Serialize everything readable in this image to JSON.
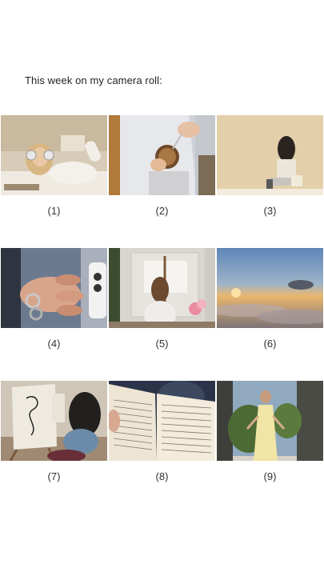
{
  "heading": "This week on my camera roll:",
  "photos": [
    {
      "caption": "(1)",
      "subject": "girl-headphones-bed-photo"
    },
    {
      "caption": "(2)",
      "subject": "coffee-cup-photo"
    },
    {
      "caption": "(3)",
      "subject": "girl-sitting-wall-photo"
    },
    {
      "caption": "(4)",
      "subject": "hand-rings-phone-photo"
    },
    {
      "caption": "(5)",
      "subject": "girl-painting-easel-photo"
    },
    {
      "caption": "(6)",
      "subject": "sunset-clouds-photo"
    },
    {
      "caption": "(7)",
      "subject": "girl-drawing-canvas-photo"
    },
    {
      "caption": "(8)",
      "subject": "open-book-photo"
    },
    {
      "caption": "(9)",
      "subject": "girl-yellow-dress-photo"
    }
  ]
}
